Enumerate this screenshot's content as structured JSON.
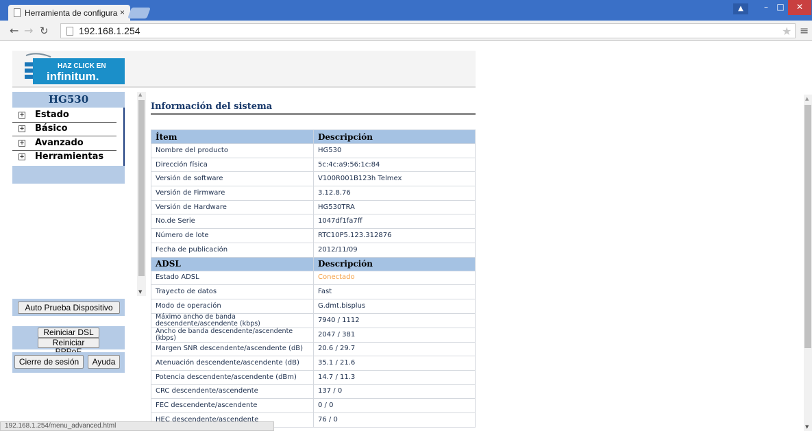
{
  "browser": {
    "tab_title": "Herramienta de configura",
    "tab_close": "×",
    "url": "192.168.1.254",
    "status_url": "192.168.1.254/menu_advanced.html"
  },
  "banner": {
    "logo_line1": "HAZ CLICK EN",
    "logo_line2": "infinitum."
  },
  "sidebar": {
    "device": "HG530",
    "items": [
      {
        "label": "Estado"
      },
      {
        "label": "Básico"
      },
      {
        "label": "Avanzado"
      },
      {
        "label": "Herramientas"
      }
    ],
    "buttons": {
      "self_test": "Auto Prueba Dispositivo",
      "restart_dsl": "Reiniciar DSL",
      "restart_pppoe": "Reiniciar PPPoE",
      "logout": "Cierre de sesión",
      "help": "Ayuda"
    }
  },
  "main": {
    "title": "Información del sistema",
    "system_header": {
      "item": "Ítem",
      "desc": "Descripción"
    },
    "system_rows": [
      {
        "label": "Nombre del producto",
        "value": "HG530"
      },
      {
        "label": "Dirección física",
        "value": "5c:4c:a9:56:1c:84"
      },
      {
        "label": "Versión de software",
        "value": "V100R001B123h Telmex"
      },
      {
        "label": "Versión de Firmware",
        "value": "3.12.8.76"
      },
      {
        "label": "Versión de Hardware",
        "value": "HG530TRA"
      },
      {
        "label": "No.de Serie",
        "value": "1047df1fa7ff"
      },
      {
        "label": "Número de lote",
        "value": "RTC10P5.123.312876"
      },
      {
        "label": "Fecha de publicación",
        "value": "2012/11/09"
      }
    ],
    "adsl_header": {
      "item": "ADSL",
      "desc": "Descripción"
    },
    "adsl_rows": [
      {
        "label": "Estado ADSL",
        "value": "Conectado"
      },
      {
        "label": "Trayecto de datos",
        "value": "Fast"
      },
      {
        "label": "Modo de operación",
        "value": "G.dmt.bisplus"
      },
      {
        "label": "Máximo ancho de banda descendente/ascendente (kbps)",
        "value": "7940 / 1112"
      },
      {
        "label": "Ancho de banda descendente/ascendente (kbps)",
        "value": "2047 / 381"
      },
      {
        "label": "Margen SNR descendente/ascendente (dB)",
        "value": "20.6 / 29.7"
      },
      {
        "label": "Atenuación descendente/ascendente (dB)",
        "value": "35.1 / 21.6"
      },
      {
        "label": "Potencia descendente/ascendente (dBm)",
        "value": "14.7 / 11.3"
      },
      {
        "label": "CRC descendente/ascendente",
        "value": "137 / 0"
      },
      {
        "label": "FEC  descendente/ascendente",
        "value": "0 / 0"
      },
      {
        "label": "HEC descendente/ascendente",
        "value": "76 / 0"
      }
    ]
  }
}
